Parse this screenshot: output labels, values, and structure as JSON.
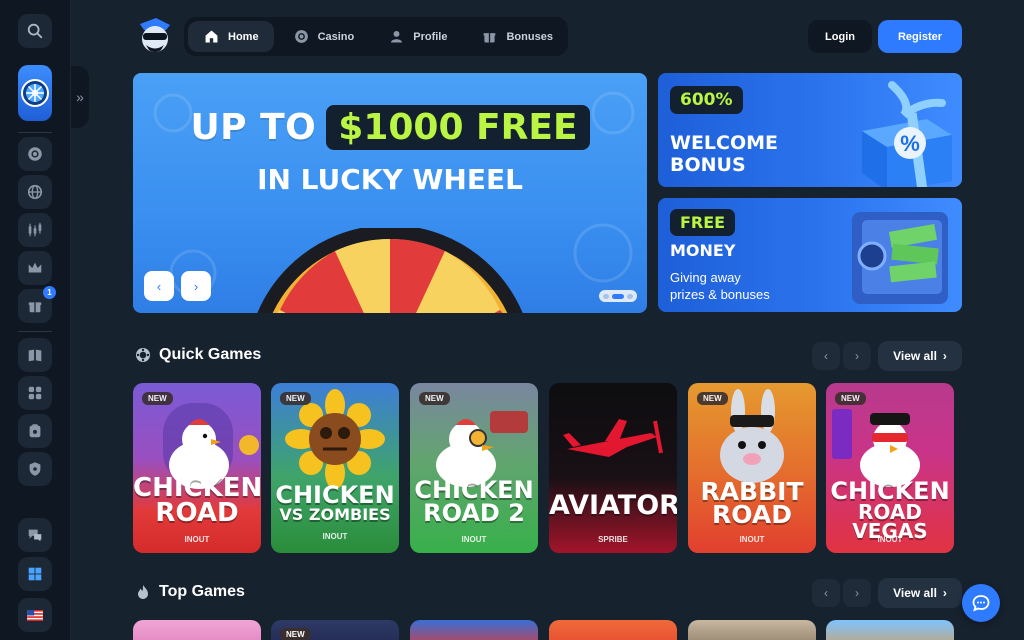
{
  "nav": {
    "items": [
      {
        "label": "Home",
        "icon": "home-icon",
        "active": true
      },
      {
        "label": "Casino",
        "icon": "casino-chip-icon",
        "active": false
      },
      {
        "label": "Profile",
        "icon": "user-icon",
        "active": false
      },
      {
        "label": "Bonuses",
        "icon": "gift-icon",
        "active": false
      }
    ],
    "login_label": "Login",
    "register_label": "Register"
  },
  "sidebar": {
    "bonus_badge": "1"
  },
  "hero": {
    "prefix": "UP TO",
    "highlight": "$1000 FREE",
    "line2": "IN LUCKY WHEEL"
  },
  "promo_welcome": {
    "pill": "600%",
    "line1": "WELCOME",
    "line2": "BONUS"
  },
  "promo_money": {
    "pill": "FREE",
    "line1": "MONEY",
    "desc1": "Giving away",
    "desc2": "prizes & bonuses"
  },
  "quick_games": {
    "title": "Quick Games",
    "view_all": "View all",
    "new_badge": "NEW",
    "cards": [
      {
        "title1": "CHICKEN",
        "title2": "ROAD",
        "provider": "INOUT",
        "new": true
      },
      {
        "title1": "CHICKEN",
        "title2": "VS ZOMBIES",
        "provider": "INOUT",
        "new": true
      },
      {
        "title1": "CHICKEN",
        "title2": "ROAD 2",
        "provider": "INOUT",
        "new": true
      },
      {
        "title1": "AVIATOR",
        "title2": "",
        "provider": "SPRIBE",
        "new": false
      },
      {
        "title1": "RABBIT",
        "title2": "ROAD",
        "provider": "INOUT",
        "new": true
      },
      {
        "title1": "CHICKEN",
        "title2": "ROAD VEGAS",
        "provider": "INOUT",
        "new": true
      }
    ]
  },
  "top_games": {
    "title": "Top Games",
    "view_all": "View all",
    "new_badge": "NEW"
  },
  "colors": {
    "accent": "#2e7bff",
    "background": "#17222f",
    "sidebar": "#0f1822",
    "lime": "#b9f542"
  }
}
